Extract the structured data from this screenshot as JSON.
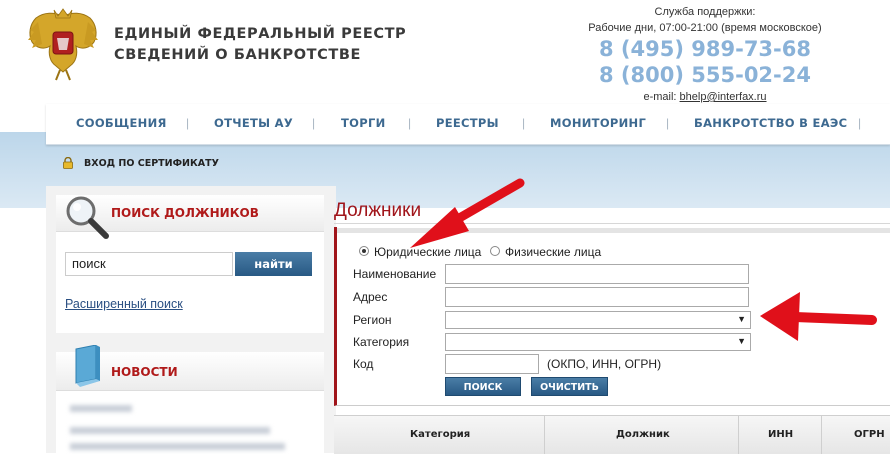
{
  "header": {
    "title_line1": "ЕДИНЫЙ ФЕДЕРАЛЬНЫЙ РЕЕСТР",
    "title_line2": "СВЕДЕНИЙ О БАНКРОТСТВЕ",
    "support_label": "Служба поддержки:",
    "support_hours": "Рабочие дни, 07:00-21:00 (время московское)",
    "phone1": "8 (495) 989-73-68",
    "phone2": "8 (800) 555-02-24",
    "email_label": "e-mail:",
    "email": "bhelp@interfax.ru"
  },
  "nav": {
    "items": [
      "СООБЩЕНИЯ",
      "ОТЧЕТЫ АУ",
      "ТОРГИ",
      "РЕЕСТРЫ",
      "МОНИТОРИНГ",
      "БАНКРОТСТВО В ЕАЭС"
    ],
    "separator": "|"
  },
  "cert": {
    "label": "ВХОД ПО СЕРТИФИКАТУ"
  },
  "sidebar": {
    "search_title": "ПОИСК ДОЛЖНИКОВ",
    "search_value": "поиск",
    "search_button": "найти",
    "advanced_link": "Расширенный поиск",
    "news_title": "НОВОСТИ"
  },
  "main": {
    "title": "Должники",
    "radio_legal": "Юридические лица",
    "radio_physical": "Физические лица",
    "fields": {
      "name": "Наименование",
      "address": "Адрес",
      "region": "Регион",
      "category": "Категория",
      "code": "Код",
      "code_hint": "(ОКПО, ИНН, ОГРН)"
    },
    "search_button": "ПОИСК",
    "clear_button": "ОЧИСТИТЬ",
    "table_headers": [
      "Категория",
      "Должник",
      "ИНН",
      "ОГРН"
    ]
  },
  "colors": {
    "accent_red": "#a0141a",
    "nav_blue": "#3d6990",
    "phone_blue": "#8ab2d8",
    "button_blue": "#285984",
    "arrow_red": "#e0101a"
  },
  "icons": [
    "emblem-icon",
    "lock-icon",
    "magnifier-icon",
    "book-icon",
    "dropdown-caret-icon",
    "arrow-icon"
  ]
}
